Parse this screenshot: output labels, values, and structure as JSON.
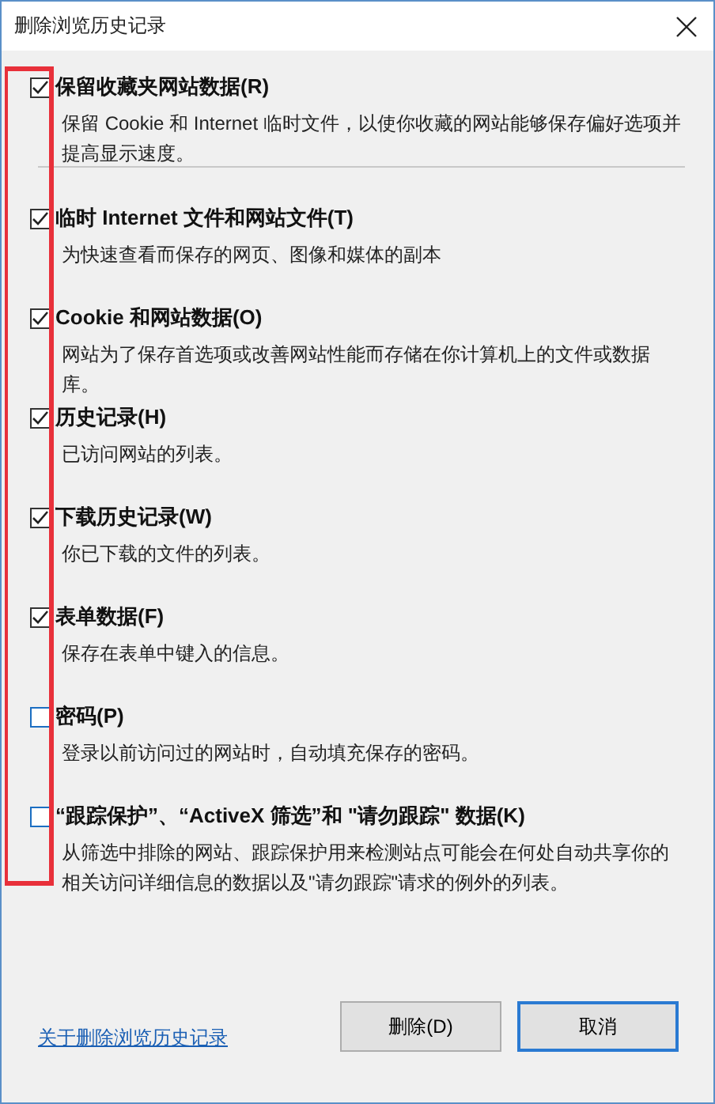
{
  "window": {
    "title": "删除浏览历史记录"
  },
  "options": [
    {
      "label": "保留收藏夹网站数据(R)",
      "description": "保留 Cookie 和 Internet 临时文件，以使你收藏的网站能够保存偏好选项并提高显示速度。",
      "checked": true
    },
    {
      "label": "临时 Internet 文件和网站文件(T)",
      "description": "为快速查看而保存的网页、图像和媒体的副本",
      "checked": true
    },
    {
      "label": "Cookie 和网站数据(O)",
      "description": "网站为了保存首选项或改善网站性能而存储在你计算机上的文件或数据库。",
      "checked": true
    },
    {
      "label": "历史记录(H)",
      "description": "已访问网站的列表。",
      "checked": true
    },
    {
      "label": "下载历史记录(W)",
      "description": "你已下载的文件的列表。",
      "checked": true
    },
    {
      "label": "表单数据(F)",
      "description": "保存在表单中键入的信息。",
      "checked": true
    },
    {
      "label": "密码(P)",
      "description": "登录以前访问过的网站时，自动填充保存的密码。",
      "checked": false
    },
    {
      "label": "“跟踪保护”、“ActiveX 筛选”和 \"请勿跟踪\" 数据(K)",
      "description": "从筛选中排除的网站、跟踪保护用来检测站点可能会在何处自动共享你的相关访问详细信息的数据以及\"请勿跟踪\"请求的例外的列表。",
      "checked": false
    }
  ],
  "footer": {
    "link": "关于删除浏览历史记录",
    "buttons": [
      {
        "label": "删除(D)",
        "kind": "normal"
      },
      {
        "label": "取消",
        "kind": "default"
      }
    ]
  }
}
